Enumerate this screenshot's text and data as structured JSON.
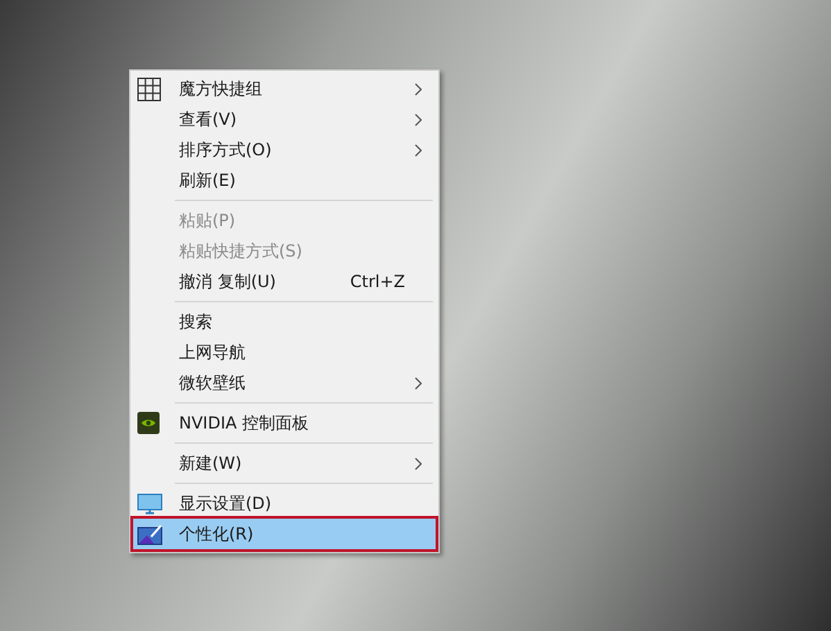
{
  "context_menu": {
    "items": [
      {
        "kind": "item",
        "label": "魔方快捷组",
        "submenu": true,
        "disabled": false,
        "selected": false
      },
      {
        "kind": "item",
        "label": "查看(V)",
        "submenu": true,
        "disabled": false,
        "selected": false
      },
      {
        "kind": "item",
        "label": "排序方式(O)",
        "submenu": true,
        "disabled": false,
        "selected": false
      },
      {
        "kind": "item",
        "label": "刷新(E)",
        "submenu": false,
        "disabled": false,
        "selected": false
      },
      {
        "kind": "separator"
      },
      {
        "kind": "item",
        "label": "粘贴(P)",
        "submenu": false,
        "disabled": true,
        "selected": false
      },
      {
        "kind": "item",
        "label": "粘贴快捷方式(S)",
        "submenu": false,
        "disabled": true,
        "selected": false
      },
      {
        "kind": "item",
        "label": "撤消 复制(U)",
        "shortcut": "Ctrl+Z",
        "submenu": false,
        "disabled": false,
        "selected": false
      },
      {
        "kind": "separator"
      },
      {
        "kind": "item",
        "label": "搜索",
        "submenu": false,
        "disabled": false,
        "selected": false
      },
      {
        "kind": "item",
        "label": "上网导航",
        "submenu": false,
        "disabled": false,
        "selected": false
      },
      {
        "kind": "item",
        "label": "微软壁纸",
        "submenu": true,
        "disabled": false,
        "selected": false
      },
      {
        "kind": "separator"
      },
      {
        "kind": "item",
        "label": "NVIDIA 控制面板",
        "submenu": false,
        "disabled": false,
        "selected": false
      },
      {
        "kind": "separator"
      },
      {
        "kind": "item",
        "label": "新建(W)",
        "submenu": true,
        "disabled": false,
        "selected": false
      },
      {
        "kind": "separator"
      },
      {
        "kind": "item",
        "label": "显示设置(D)",
        "submenu": false,
        "disabled": false,
        "selected": false
      },
      {
        "kind": "item",
        "label": "个性化(R)",
        "submenu": false,
        "disabled": false,
        "selected": true
      }
    ]
  }
}
